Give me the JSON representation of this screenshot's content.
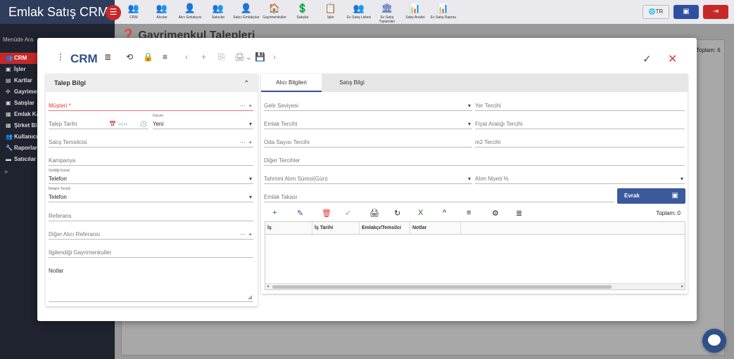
{
  "app": {
    "brand": "Emlak Satış CRM",
    "menu_icon": "☰",
    "modules": [
      {
        "icon": "👥",
        "label": "CRM",
        "color": "#2f4f8a"
      },
      {
        "icon": "👥",
        "label": "Alıcılar",
        "color": "#2f4f8a"
      },
      {
        "icon": "👤",
        "label": "Alıcı Emlakçısı",
        "color": "#f2a900"
      },
      {
        "icon": "👥",
        "label": "Satıcılar",
        "color": "#2e8b3a"
      },
      {
        "icon": "👤",
        "label": "Satıcı Emlakçılar",
        "color": "#c62828"
      },
      {
        "icon": "🏠",
        "label": "Gayrimenkuller",
        "color": "#c62828"
      },
      {
        "icon": "💲",
        "label": "Satışlar",
        "color": "#2f4fa0"
      },
      {
        "icon": "📋",
        "label": "İşler",
        "color": "#d81b60"
      },
      {
        "icon": "👥",
        "label": "Ev Satış Listesi",
        "color": "#f2a900"
      },
      {
        "icon": "🏛",
        "label": "Ev Satış Toplamları",
        "color": "#2f4fa0"
      },
      {
        "icon": "📊",
        "label": "Satış Analizi",
        "color": "#d81b60"
      },
      {
        "icon": "📊",
        "label": "Ev Satış Raporu",
        "color": "#d81b60"
      }
    ],
    "lang": "🌐TR",
    "sidebar_search": "Menüde Ara",
    "sidebar_items": [
      {
        "icon": "👥",
        "label": "CRM",
        "active": true
      },
      {
        "icon": "▣",
        "label": "İşler"
      },
      {
        "icon": "▤",
        "label": "Kartlar"
      },
      {
        "icon": "✣",
        "label": "Gayrimenkuller"
      },
      {
        "icon": "▣",
        "label": "Satışlar"
      },
      {
        "icon": "▦",
        "label": "Emlak Kartları"
      },
      {
        "icon": "▦",
        "label": "Şirket Bilgileri"
      },
      {
        "icon": "👥",
        "label": "Kullanıcılar"
      },
      {
        "icon": "🔧",
        "label": "Raporlar"
      },
      {
        "icon": "▬",
        "label": "Satıcılar Menüsü"
      }
    ],
    "sidebar_collapse": "»",
    "page_title": "❓ Gayrimenkul Talepleri",
    "page_total": "Toplam: 6"
  },
  "modal": {
    "title": "CRM",
    "toolbar_icons": [
      "⋮",
      "≣",
      "⟲",
      "🔒",
      "≡",
      "‹",
      "+",
      "⎘",
      "🖨⌄",
      "💾",
      "›"
    ],
    "confirm_icon": "✓",
    "close_icon": "✕"
  },
  "left_card": {
    "title": "Talep Bilgi",
    "collapse_icon": "⌃",
    "musteri_label": "Müşteri *",
    "talep_tarihi_label": "Talep Tarihi",
    "time_placeholder": "--:--",
    "durum_label": "Durum",
    "durum_value": "Yeni",
    "satis_temsilcisi_label": "Satış Temsilcisi",
    "kampanya_label": "Kampanya",
    "geldigi_kanal_label": "Geldiği Kanal",
    "geldigi_kanal_value": "Telefon",
    "iletisim_tercihi_label": "İletişim Tercihi",
    "iletisim_tercihi_value": "Telefon",
    "referans_label": "Referans",
    "diger_alici_referansi_label": "Diğer Alıcı Referansı",
    "ilgilendigi_label": "İlgilendiği Gayrimenkuller",
    "notlar_label": "Notlar",
    "lookup_icon": "···",
    "add_icon": "+",
    "dropdown_icon": "▾",
    "calendar_icon": "📅",
    "clock_icon": "🕒"
  },
  "right_card": {
    "tabs": [
      "Alıcı Bilgileri",
      "Satış Bilgi"
    ],
    "fields": {
      "gelir_seviyesi": "Gelir Seviyesi",
      "yer_tercihi": "Yer Tercihi",
      "emlak_tercihi": "Emlak Tercihi",
      "fiyat_araligi": "Fiyat Aralığı Tercihi",
      "oda_sayisi": "Oda Sayısı Tercihi",
      "m2_tercihi": "m2 Tercihi",
      "diger_tercihler": "Diğer Tercihler",
      "tahmini_alim": "Tahmini Alım Süresi(Gün)",
      "alim_niyeti": "Alım Niyeti %",
      "emlak_takasi": "Emlak Takası"
    },
    "evrak_label": "Evrak",
    "evrak_icon": "▣",
    "grid_toolbar": [
      {
        "icon": "+",
        "color": "#2f4fa0"
      },
      {
        "icon": "✎",
        "color": "#2f4fa0"
      },
      {
        "icon": "🗑",
        "color": "#e53935"
      },
      {
        "icon": "✔",
        "color": "#bbbbbb"
      },
      {
        "icon": "🖨",
        "color": "#222222"
      },
      {
        "icon": "↻",
        "color": "#222222"
      },
      {
        "icon": "X",
        "color": "#1e6e3c"
      },
      {
        "icon": "^",
        "color": "#222222"
      },
      {
        "icon": "≡",
        "color": "#222222"
      },
      {
        "icon": "⚙",
        "color": "#222222"
      },
      {
        "icon": "≣",
        "color": "#222222"
      }
    ],
    "grid_total": "Toplam: 0",
    "grid_columns": [
      "İş",
      "İş Tarihi",
      "Emlakçı/Temsilci",
      "Notlar"
    ],
    "scroll_left": "◂",
    "scroll_right": "▸"
  }
}
